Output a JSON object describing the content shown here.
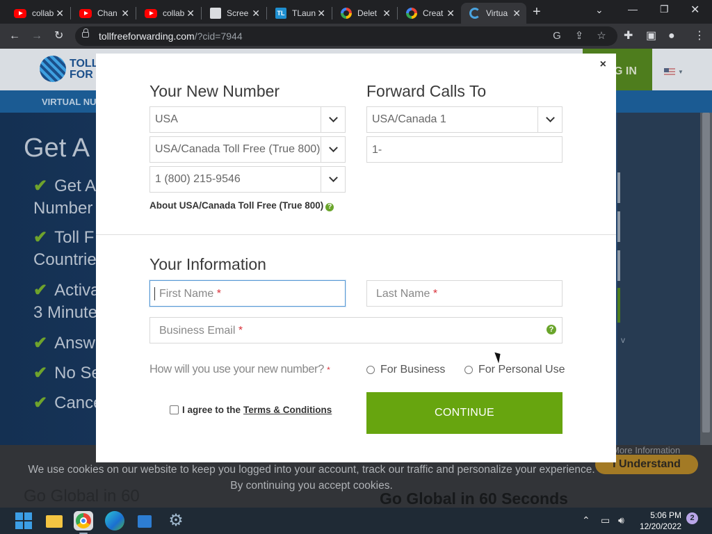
{
  "browser": {
    "tabs": [
      {
        "label": "collab",
        "favicon": "youtube-icon"
      },
      {
        "label": "Chan",
        "favicon": "youtube-icon"
      },
      {
        "label": "collab",
        "favicon": "youtube-icon"
      },
      {
        "label": "Scree",
        "favicon": "screen-icon"
      },
      {
        "label": "TLaun",
        "favicon": "tl-icon"
      },
      {
        "label": "Delet",
        "favicon": "google-icon"
      },
      {
        "label": "Creat",
        "favicon": "google-icon"
      },
      {
        "label": "Virtua",
        "favicon": "site-icon",
        "active": true
      }
    ],
    "url_main": "tollfreeforwarding.com",
    "url_rest": "/?cid=7944",
    "tl_glyph": "TL"
  },
  "site": {
    "logo_text_1": "TOLL",
    "logo_text_2": "FOR",
    "login_label": "G IN",
    "nav_label": "VIRTUAL NU",
    "hero_title": "Get A S",
    "bullets": [
      {
        "line1": "Get A",
        "line2": "Number"
      },
      {
        "line1": "Toll F",
        "line2": "Countrie"
      },
      {
        "line1": "Activa",
        "line2": "3 Minute"
      },
      {
        "line1": "Answ"
      },
      {
        "line1": "No Se"
      },
      {
        "line1": "Cance"
      }
    ],
    "side_note": "v",
    "lower_heading_left": "Go Global in 60",
    "lower_heading_right": "Go Global in 60 Seconds"
  },
  "modal": {
    "close_label": "×",
    "your_new_number": {
      "title": "Your New Number",
      "country": "USA",
      "number_type": "USA/Canada Toll Free (True 800)",
      "number": "1 (800) 215-9546",
      "about_text": "About USA/Canada Toll Free (True 800)"
    },
    "forward_calls_to": {
      "title": "Forward Calls To",
      "country": "USA/Canada 1",
      "phone_value": "1-"
    },
    "your_information": {
      "title": "Your Information",
      "first_name_placeholder": "First Name",
      "last_name_placeholder": "Last Name",
      "email_placeholder": "Business Email",
      "required_mark": "*",
      "use_question": "How will you use your new number?",
      "option_business": "For Business",
      "option_personal": "For Personal Use",
      "agree_prefix": "I agree to the",
      "terms_link": "Terms & Conditions",
      "continue_label": "CONTINUE"
    },
    "help_glyph": "?"
  },
  "cookie": {
    "text": "We use cookies on our website to keep you logged into your account, track our traffic and personalize your experience. By continuing you accept cookies.",
    "more_info": "More Information",
    "understand_label": "I Understand"
  },
  "taskbar": {
    "time": "5:06 PM",
    "date": "12/20/2022",
    "notifications": "2"
  },
  "colors": {
    "accent_green": "#67a50f",
    "focus_blue": "#5b9bd5",
    "required_red": "#d9313a"
  }
}
